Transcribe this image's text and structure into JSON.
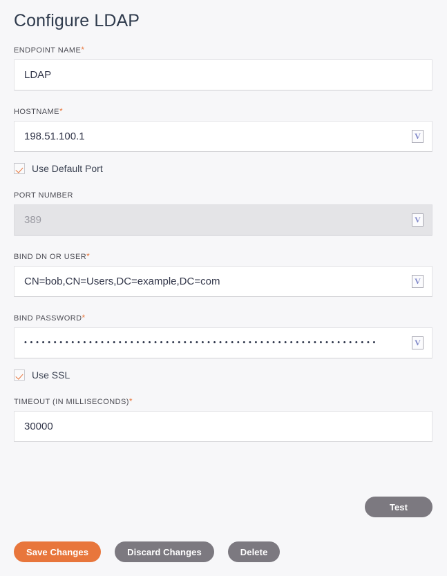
{
  "page": {
    "title": "Configure LDAP"
  },
  "fields": {
    "endpoint_name": {
      "label": "ENDPOINT NAME",
      "required": "*",
      "value": "LDAP",
      "has_variable_icon": false,
      "icon": "variable-icon",
      "disabled": false
    },
    "hostname": {
      "label": "HOSTNAME",
      "required": "*",
      "value": "198.51.100.1",
      "has_variable_icon": true,
      "icon": "variable-icon",
      "icon_glyph": "V",
      "disabled": false
    },
    "use_default_port": {
      "label": "Use Default Port",
      "checked": true
    },
    "port_number": {
      "label": "PORT NUMBER",
      "required": "",
      "value": "389",
      "has_variable_icon": true,
      "icon_glyph": "V",
      "disabled": true
    },
    "bind_dn_or_user": {
      "label": "BIND DN OR USER",
      "required": "*",
      "value": "CN=bob,CN=Users,DC=example,DC=com",
      "has_variable_icon": true,
      "icon_glyph": "V",
      "disabled": false
    },
    "bind_password": {
      "label": "BIND PASSWORD",
      "required": "*",
      "value": "••••••••••••••••••••••••••••••••••••••••••••••••••••••••••••",
      "has_variable_icon": true,
      "icon_glyph": "V",
      "disabled": false
    },
    "use_ssl": {
      "label": "Use SSL",
      "checked": true
    },
    "timeout": {
      "label": "TIMEOUT (IN MILLISECONDS)",
      "required": "*",
      "value": "30000",
      "has_variable_icon": false,
      "disabled": false
    }
  },
  "buttons": {
    "test": "Test",
    "save_changes": "Save Changes",
    "discard_changes": "Discard Changes",
    "delete": "Delete"
  },
  "colors": {
    "accent": "#e8763c",
    "secondary": "#7c7980",
    "page_bg": "#f7f7f9",
    "title": "#2f3b4d",
    "field_border": "#e3e3e6",
    "disabled_bg": "#e4e4e7"
  }
}
